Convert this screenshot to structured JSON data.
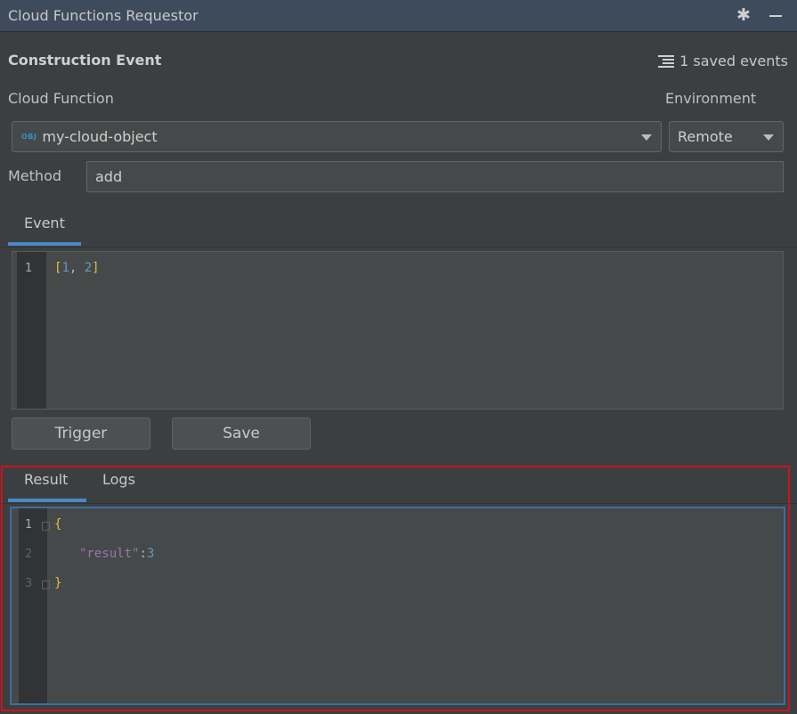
{
  "window": {
    "title": "Cloud Functions Requestor",
    "icons": [
      "gear-icon",
      "minimize-icon"
    ]
  },
  "header": {
    "section_title": "Construction Event",
    "saved_events": "1 saved events"
  },
  "form": {
    "cloud_function_label": "Cloud Function",
    "cloud_function_value": "my-cloud-object",
    "cloud_function_icon": "OBJ",
    "environment_label": "Environment",
    "environment_value": "Remote",
    "method_label": "Method",
    "method_value": "add"
  },
  "event_tabs": [
    {
      "label": "Event",
      "active": true
    }
  ],
  "event_editor": {
    "lines": [
      {
        "number": "1",
        "open": "[",
        "v1": "1",
        "sep": ", ",
        "v2": "2",
        "close": "]"
      }
    ]
  },
  "buttons": {
    "trigger": "Trigger",
    "save": "Save"
  },
  "result_tabs": [
    {
      "label": "Result",
      "active": true
    },
    {
      "label": "Logs",
      "active": false
    }
  ],
  "result_editor": {
    "line_numbers": [
      "1",
      "2",
      "3"
    ],
    "open_brace": "{",
    "key": "\"result\"",
    "colon": ":",
    "value": "3",
    "close_brace": "}"
  },
  "colors": {
    "accent": "#4a88c7",
    "highlight_border": "#d0121b",
    "bracket": "#e8bf3a",
    "number": "#6897bb",
    "key": "#9876aa"
  }
}
